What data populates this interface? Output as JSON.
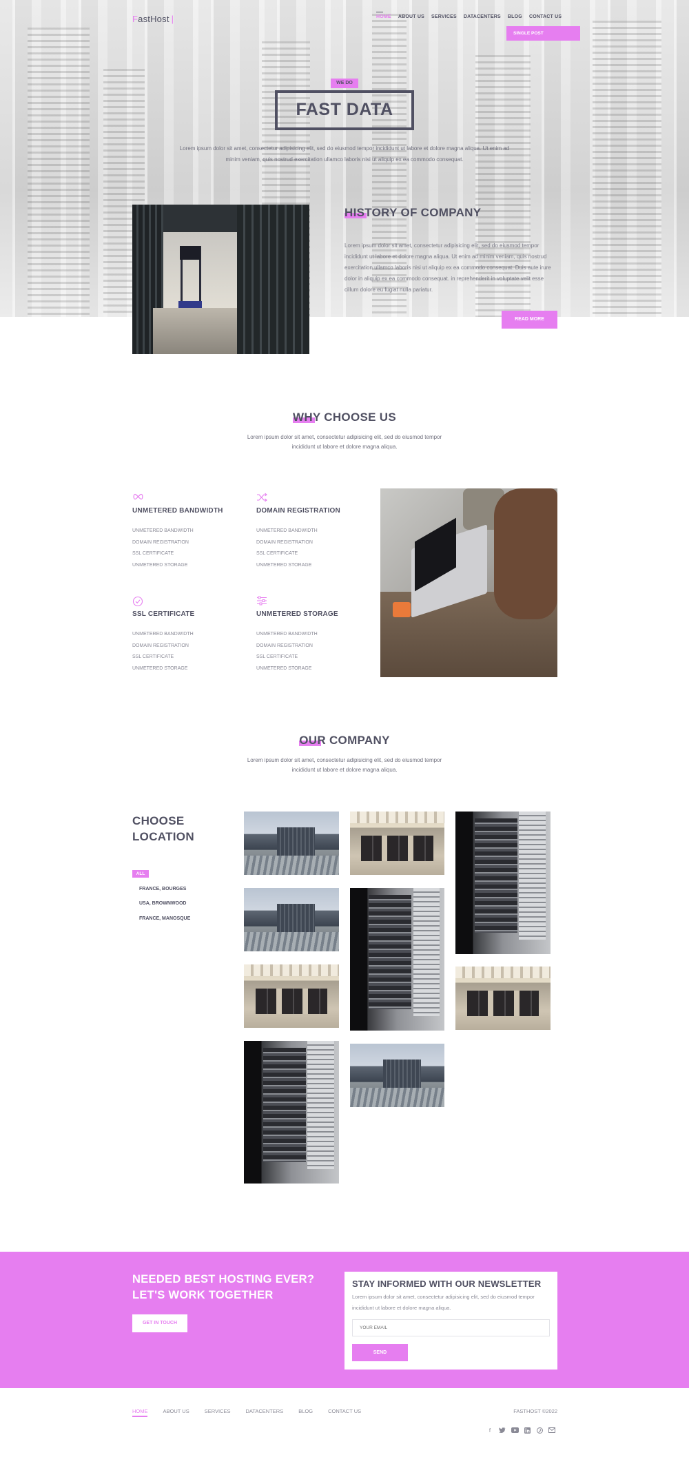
{
  "header": {
    "logo_first": "F",
    "logo_rest": "astHost",
    "logo_bar": "|",
    "nav": [
      "HOME",
      "ABOUT US",
      "SERVICES",
      "DATACENTERS",
      "BLOG",
      "CONTACT US"
    ],
    "cta_label": "SINGLE POST"
  },
  "hero": {
    "tag": "WE DO",
    "title": "FAST DATA",
    "text": "Lorem ipsum dolor sit amet, consectetur adipisicing elit, sed do eiusmod tempor incididunt ut labore et dolore magna aliqua. Ut enim ad minim veniam, quis nostrud exercitation ullamco laboris nisi ut aliquip ex ea commodo consequat."
  },
  "history": {
    "title": "HISTORY OF COMPANY",
    "text": "Lorem ipsum dolor sit amet, consectetur adipisicing elit, sed do eiusmod tempor incididunt ut labore et dolore magna aliqua. Ut enim ad minim veniam, quis nostrud exercitation ullamco laboris nisi ut aliquip ex ea commodo consequat. Duis aute irure dolor in aliquip ex ea commodo consequat. in reprehenderit in voluptate velit esse cillum dolore eu fugiat nulla pariatur.",
    "button": "READ MORE"
  },
  "why": {
    "title": "WHY CHOOSE US",
    "text": "Lorem ipsum dolor sit amet, consectetur adipisicing elit, sed do eiusmod tempor incididunt ut labore et dolore magna aliqua.",
    "features": [
      {
        "icon": "infinity-icon",
        "title": "UNMETERED BANDWIDTH",
        "items": [
          "UNMETERED BANDWIDTH",
          "DOMAIN REGISTRATION",
          "SSL CERTIFICATE",
          "UNMETERED STORAGE"
        ]
      },
      {
        "icon": "shuffle-icon",
        "title": "DOMAIN REGISTRATION",
        "items": [
          "UNMETERED BANDWIDTH",
          "DOMAIN REGISTRATION",
          "SSL CERTIFICATE",
          "UNMETERED STORAGE"
        ]
      },
      {
        "icon": "check-circle-icon",
        "title": "SSL CERTIFICATE",
        "items": [
          "UNMETERED BANDWIDTH",
          "DOMAIN REGISTRATION",
          "SSL CERTIFICATE",
          "UNMETERED STORAGE"
        ]
      },
      {
        "icon": "sliders-icon",
        "title": "UNMETERED STORAGE",
        "items": [
          "UNMETERED BANDWIDTH",
          "DOMAIN REGISTRATION",
          "SSL CERTIFICATE",
          "UNMETERED STORAGE"
        ]
      }
    ]
  },
  "company": {
    "title": "OUR COMPANY",
    "text": "Lorem ipsum dolor sit amet, consectetur adipisicing elit, sed do eiusmod tempor incididunt ut labore et dolore magna aliqua.",
    "choose_line1": "CHOOSE",
    "choose_line2": "LOCATION",
    "filter_all": "ALL",
    "locations": [
      "FRANCE, BOURGES",
      "USA, BROWNWOOD",
      "FRANCE, MANOSQUE"
    ]
  },
  "cta": {
    "line1": "NEEDED BEST HOSTING EVER?",
    "line2": "LET'S WORK TOGETHER",
    "button": "GET IN TOUCH"
  },
  "newsletter": {
    "title": "STAY INFORMED WITH OUR NEWSLETTER",
    "text": "Lorem ipsum dolor sit amet, consectetur adipisicing elit, sed do eiusmod tempor incididunt ut labore et dolore magna aliqua.",
    "placeholder": "YOUR EMAIL",
    "button": "SEND"
  },
  "footer": {
    "nav": [
      "HOME",
      "ABOUT US",
      "SERVICES",
      "DATACENTERS",
      "BLOG",
      "CONTACT US"
    ],
    "copyright": "FASTHOST ©2022",
    "socials": [
      "facebook-icon",
      "twitter-icon",
      "youtube-icon",
      "linkedin-icon",
      "pinterest-icon",
      "email-icon"
    ]
  },
  "colors": {
    "accent": "#e67ef0",
    "text": "#505062"
  }
}
